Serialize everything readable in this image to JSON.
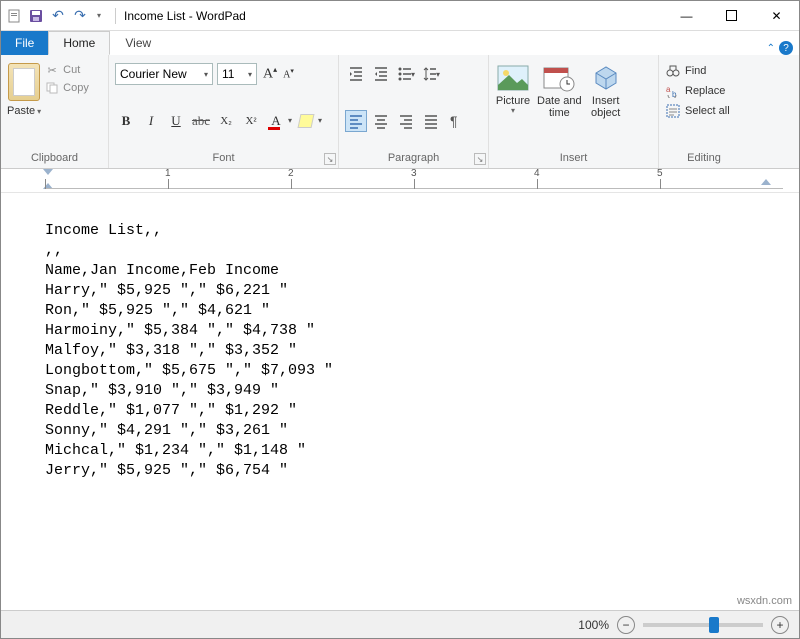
{
  "title": "Income List - WordPad",
  "tabs": {
    "file": "File",
    "home": "Home",
    "view": "View"
  },
  "clipboard": {
    "paste": "Paste",
    "cut": "Cut",
    "copy": "Copy",
    "group": "Clipboard"
  },
  "font": {
    "name": "Courier New",
    "size": "11",
    "group": "Font"
  },
  "paragraph": {
    "group": "Paragraph"
  },
  "insert": {
    "picture": "Picture",
    "datetime_l1": "Date and",
    "datetime_l2": "time",
    "object_l1": "Insert",
    "object_l2": "object",
    "group": "Insert"
  },
  "editing": {
    "find": "Find",
    "replace": "Replace",
    "selectall": "Select all",
    "group": "Editing"
  },
  "ruler": [
    "1",
    "2",
    "3",
    "4",
    "5"
  ],
  "document_lines": [
    "Income List,,",
    ",,",
    "Name,Jan Income,Feb Income",
    "Harry,\" $5,925 \",\" $6,221 \"",
    "Ron,\" $5,925 \",\" $4,621 \"",
    "Harmoiny,\" $5,384 \",\" $4,738 \"",
    "Malfoy,\" $3,318 \",\" $3,352 \"",
    "Longbottom,\" $5,675 \",\" $7,093 \"",
    "Snap,\" $3,910 \",\" $3,949 \"",
    "Reddle,\" $1,077 \",\" $1,292 \"",
    "Sonny,\" $4,291 \",\" $3,261 \"",
    "Michcal,\" $1,234 \",\" $1,148 \"",
    "Jerry,\" $5,925 \",\" $6,754 \""
  ],
  "status": {
    "zoom_value": "100%"
  },
  "watermark": "wsxdn.com"
}
